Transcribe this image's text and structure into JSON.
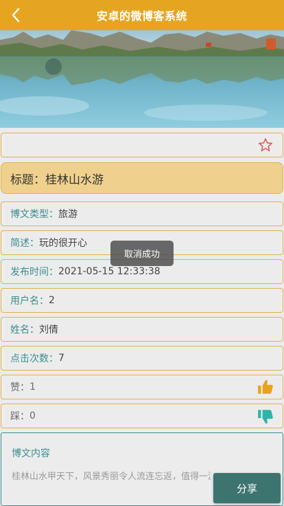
{
  "header": {
    "title": "安卓的微博客系统"
  },
  "post": {
    "title_key": "标题：",
    "title_value": "桂林山水游",
    "fields": [
      {
        "key": "博文类型：",
        "value": "旅游"
      },
      {
        "key": "简述：",
        "value": "玩的很开心"
      },
      {
        "key": "发布时间：",
        "value": "2021-05-15 12:33:38"
      },
      {
        "key": "用户名：",
        "value": "2"
      },
      {
        "key": "姓名：",
        "value": "刘倩"
      },
      {
        "key": "点击次数：",
        "value": "7"
      }
    ],
    "like": {
      "key": "赞：",
      "value": "1"
    },
    "dislike": {
      "key": "踩：",
      "value": "0"
    },
    "content_title": "博文内容",
    "content_text": "桂林山水甲天下，风景秀丽令人流连忘返，值得一游的好地方"
  },
  "toast": {
    "text": "取消成功"
  },
  "actions": {
    "share_label": "分享"
  },
  "colors": {
    "header": "#e6a521",
    "accent": "#3b8d8e",
    "like_icon": "#e8a21e",
    "dislike_icon": "#2bb6a8",
    "star": "#d9534f"
  }
}
